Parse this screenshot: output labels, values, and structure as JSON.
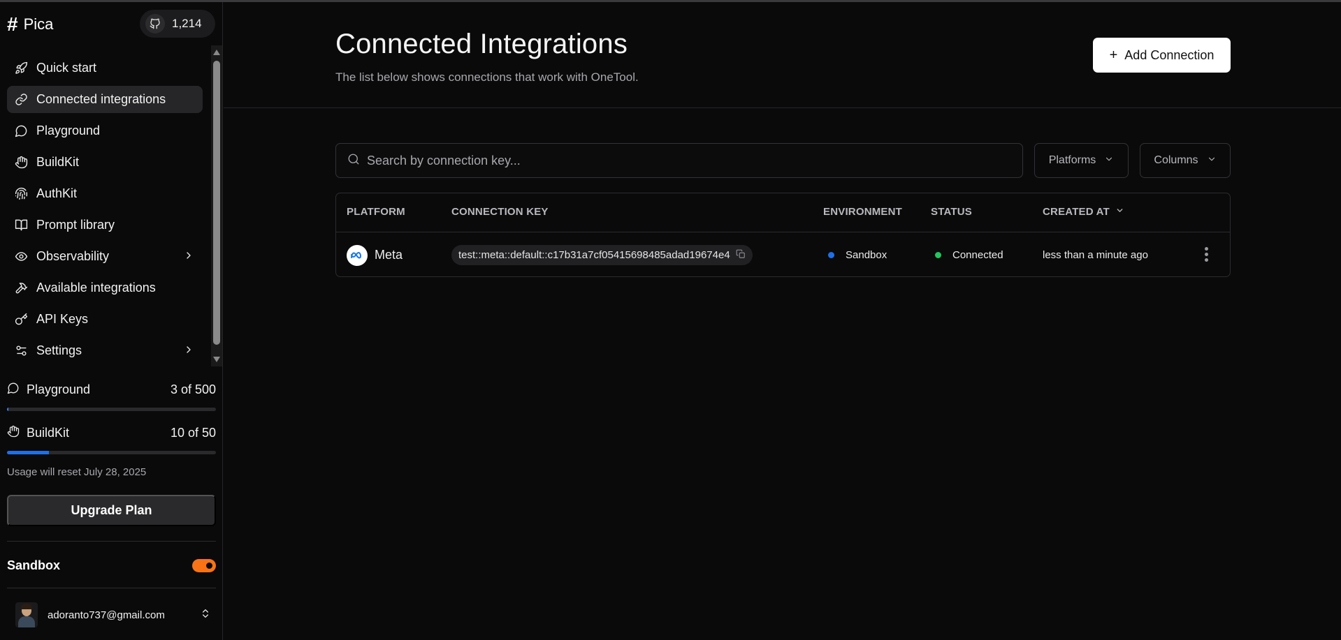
{
  "brand": {
    "name": "Pica",
    "github_count": "1,214"
  },
  "sidebar": {
    "items": [
      {
        "label": "Quick start",
        "icon": "rocket-icon"
      },
      {
        "label": "Connected integrations",
        "icon": "link-icon",
        "active": true
      },
      {
        "label": "Playground",
        "icon": "chat-bubble-icon"
      },
      {
        "label": "BuildKit",
        "icon": "hand-icon"
      },
      {
        "label": "AuthKit",
        "icon": "fingerprint-icon"
      },
      {
        "label": "Prompt library",
        "icon": "book-open-icon"
      },
      {
        "label": "Observability",
        "icon": "eye-icon",
        "has_submenu": true
      },
      {
        "label": "Available integrations",
        "icon": "tools-icon"
      },
      {
        "label": "API Keys",
        "icon": "key-icon"
      },
      {
        "label": "Settings",
        "icon": "sliders-icon",
        "has_submenu": true
      }
    ],
    "usage": [
      {
        "label": "Playground",
        "value": "3 of 500",
        "fraction": 0.006
      },
      {
        "label": "BuildKit",
        "value": "10 of 50",
        "fraction": 0.2
      }
    ],
    "reset_text": "Usage will reset July 28, 2025",
    "upgrade_label": "Upgrade Plan",
    "sandbox_label": "Sandbox",
    "sandbox_enabled": true,
    "user_email": "adoranto737@gmail.com"
  },
  "header": {
    "title": "Connected Integrations",
    "subtitle": "The list below shows connections that work with OneTool.",
    "add_button": "Add Connection"
  },
  "search": {
    "placeholder": "Search by connection key...",
    "value": ""
  },
  "filters": {
    "platforms": "Platforms",
    "columns": "Columns"
  },
  "table": {
    "headers": {
      "platform": "PLATFORM",
      "key": "CONNECTION KEY",
      "environment": "ENVIRONMENT",
      "status": "STATUS",
      "created": "CREATED AT"
    },
    "rows": [
      {
        "platform": "Meta",
        "key": "test::meta::default::c17b31a7cf05415698485adad19674e4",
        "environment": "Sandbox",
        "status": "Connected",
        "created": "less than a minute ago"
      }
    ]
  },
  "colors": {
    "accent_blue": "#1f6feb",
    "status_green": "#22c55e",
    "toggle_orange": "#f97316"
  }
}
